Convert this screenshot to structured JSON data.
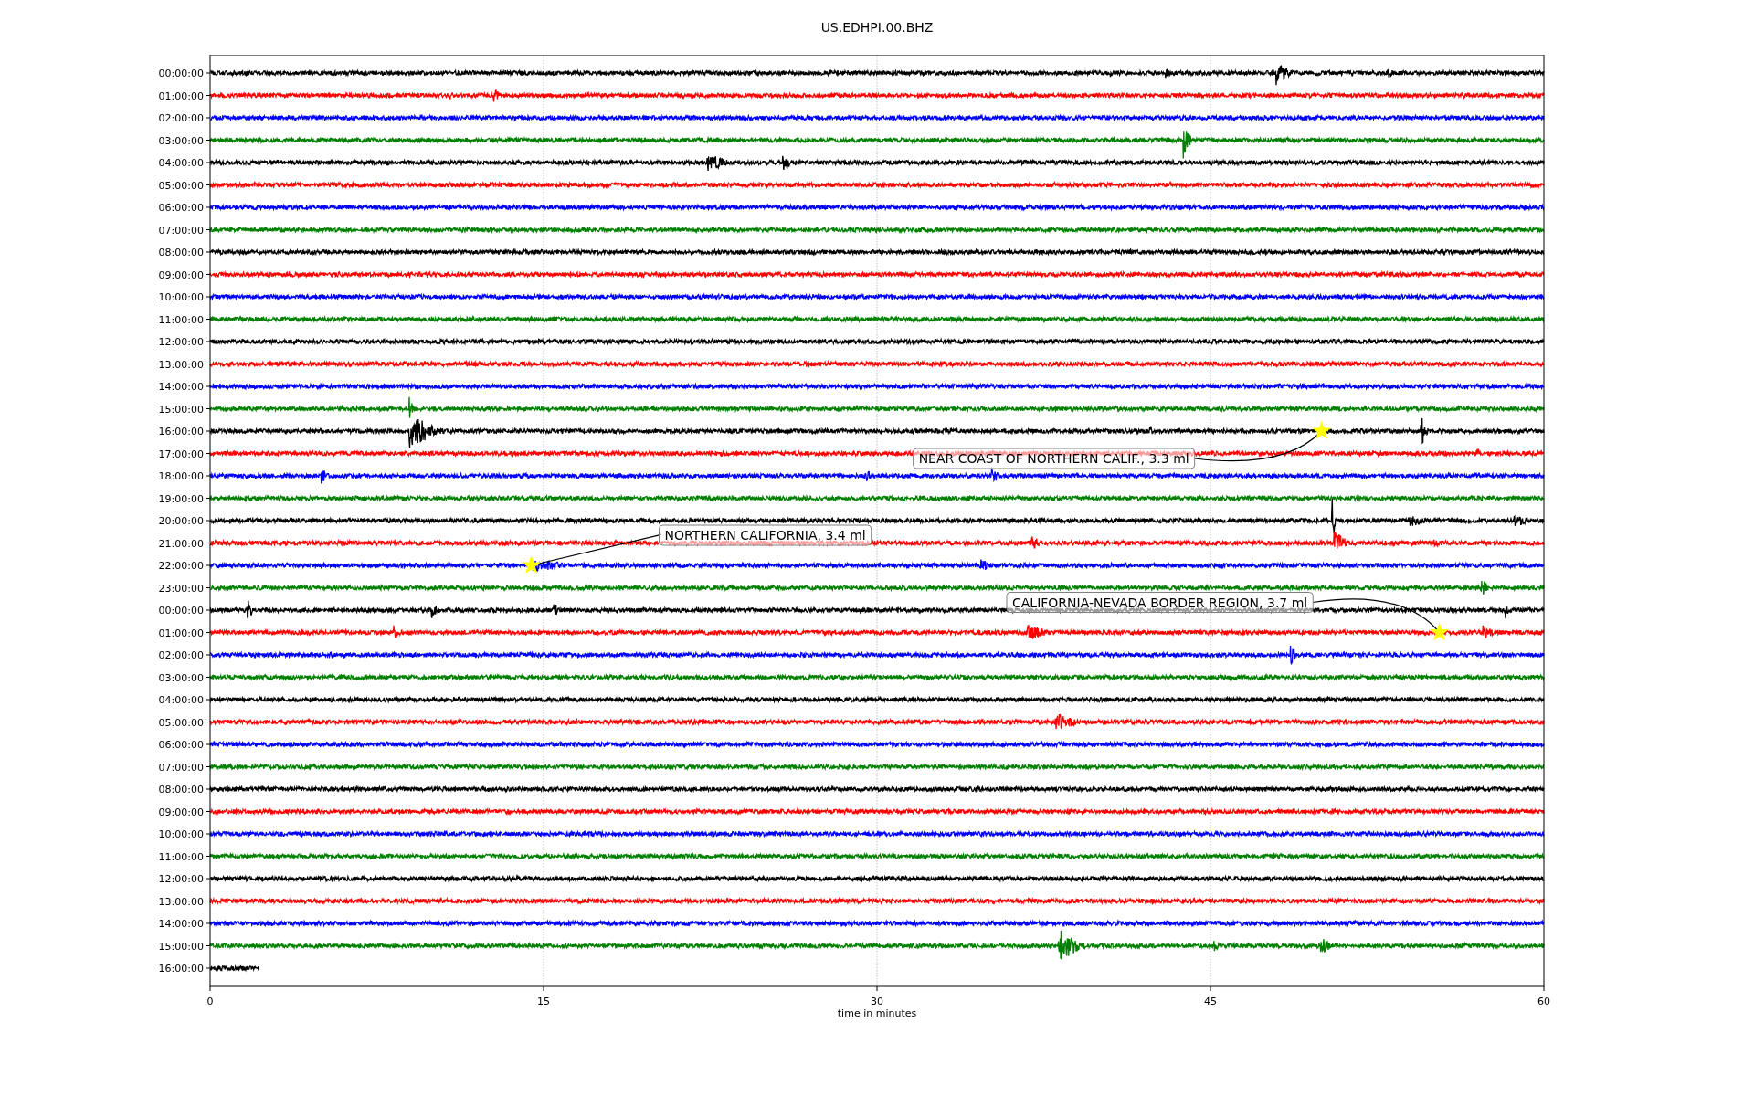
{
  "title": "US.EDHPI.00.BHZ",
  "plot": {
    "xlabel": "time in minutes",
    "xticks": [
      "0",
      "15",
      "30",
      "45",
      "60"
    ],
    "rows": [
      {
        "label": "00:00:00",
        "color": "#000000"
      },
      {
        "label": "01:00:00",
        "color": "#ff0000"
      },
      {
        "label": "02:00:00",
        "color": "#0000ff"
      },
      {
        "label": "03:00:00",
        "color": "#008000"
      },
      {
        "label": "04:00:00",
        "color": "#000000"
      },
      {
        "label": "05:00:00",
        "color": "#ff0000"
      },
      {
        "label": "06:00:00",
        "color": "#0000ff"
      },
      {
        "label": "07:00:00",
        "color": "#008000"
      },
      {
        "label": "08:00:00",
        "color": "#000000"
      },
      {
        "label": "09:00:00",
        "color": "#ff0000"
      },
      {
        "label": "10:00:00",
        "color": "#0000ff"
      },
      {
        "label": "11:00:00",
        "color": "#008000"
      },
      {
        "label": "12:00:00",
        "color": "#000000"
      },
      {
        "label": "13:00:00",
        "color": "#ff0000"
      },
      {
        "label": "14:00:00",
        "color": "#0000ff"
      },
      {
        "label": "15:00:00",
        "color": "#008000"
      },
      {
        "label": "16:00:00",
        "color": "#000000"
      },
      {
        "label": "17:00:00",
        "color": "#ff0000"
      },
      {
        "label": "18:00:00",
        "color": "#0000ff"
      },
      {
        "label": "19:00:00",
        "color": "#008000"
      },
      {
        "label": "20:00:00",
        "color": "#000000"
      },
      {
        "label": "21:00:00",
        "color": "#ff0000"
      },
      {
        "label": "22:00:00",
        "color": "#0000ff"
      },
      {
        "label": "23:00:00",
        "color": "#008000"
      },
      {
        "label": "00:00:00",
        "color": "#000000"
      },
      {
        "label": "01:00:00",
        "color": "#ff0000"
      },
      {
        "label": "02:00:00",
        "color": "#0000ff"
      },
      {
        "label": "03:00:00",
        "color": "#008000"
      },
      {
        "label": "04:00:00",
        "color": "#000000"
      },
      {
        "label": "05:00:00",
        "color": "#ff0000"
      },
      {
        "label": "06:00:00",
        "color": "#0000ff"
      },
      {
        "label": "07:00:00",
        "color": "#008000"
      },
      {
        "label": "08:00:00",
        "color": "#000000"
      },
      {
        "label": "09:00:00",
        "color": "#ff0000"
      },
      {
        "label": "10:00:00",
        "color": "#0000ff"
      },
      {
        "label": "11:00:00",
        "color": "#008000"
      },
      {
        "label": "12:00:00",
        "color": "#000000"
      },
      {
        "label": "13:00:00",
        "color": "#ff0000"
      },
      {
        "label": "14:00:00",
        "color": "#0000ff"
      },
      {
        "label": "15:00:00",
        "color": "#008000"
      },
      {
        "label": "16:00:00",
        "color": "#000000"
      }
    ],
    "events": [
      {
        "text": "NEAR COAST OF NORTHERN CALIF., 3.3 ml"
      },
      {
        "text": "NORTHERN CALIFORNIA, 3.4 ml"
      },
      {
        "text": "CALIFORNIA-NEVADA BORDER REGION, 3.7 ml"
      }
    ]
  }
}
